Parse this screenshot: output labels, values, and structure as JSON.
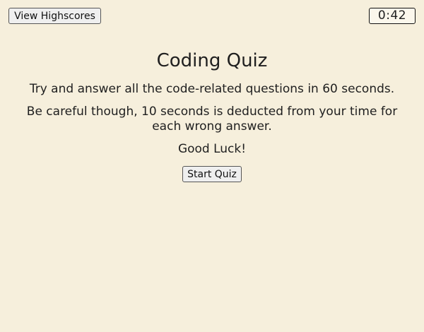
{
  "header": {
    "highscores_label": "View Highscores",
    "timer_value": "0:42"
  },
  "main": {
    "title": "Coding Quiz",
    "instructions": [
      "Try and answer all the code-related questions in 60 seconds.",
      "Be careful though, 10 seconds is deducted from your time for each wrong answer.",
      "Good Luck!"
    ],
    "start_label": "Start Quiz"
  },
  "colors": {
    "background": "#f6efdc",
    "text": "#1f1f1f",
    "button_bg": "#efefef"
  }
}
